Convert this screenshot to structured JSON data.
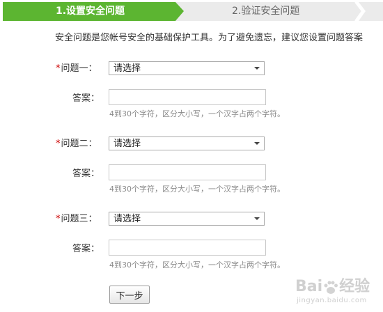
{
  "steps": {
    "step1_label": "1.设置安全问题",
    "step2_label": "2.验证安全问题",
    "active_color": "#5cb531",
    "inactive_color": "#ebebeb"
  },
  "intro_text": "安全问题是您帐号安全的基础保护工具。为了避免遗忘，建议您设置问题答案",
  "required_mark": "*",
  "questions": [
    {
      "label": "问题一：",
      "selected": "请选择",
      "answer_label": "答案：",
      "answer_value": "",
      "hint": "4到30个字符，区分大小写，一个汉字占两个字符。"
    },
    {
      "label": "问题二：",
      "selected": "请选择",
      "answer_label": "答案：",
      "answer_value": "",
      "hint": "4到30个字符，区分大小写，一个汉字占两个字符。"
    },
    {
      "label": "问题三：",
      "selected": "请选择",
      "answer_label": "答案：",
      "answer_value": "",
      "hint": "4到30个字符，区分大小写，一个汉字占两个字符。"
    }
  ],
  "next_button_label": "下一步",
  "watermark": {
    "text": "Bai",
    "text2": "经验",
    "sub": "jingyan.baidu.com"
  }
}
